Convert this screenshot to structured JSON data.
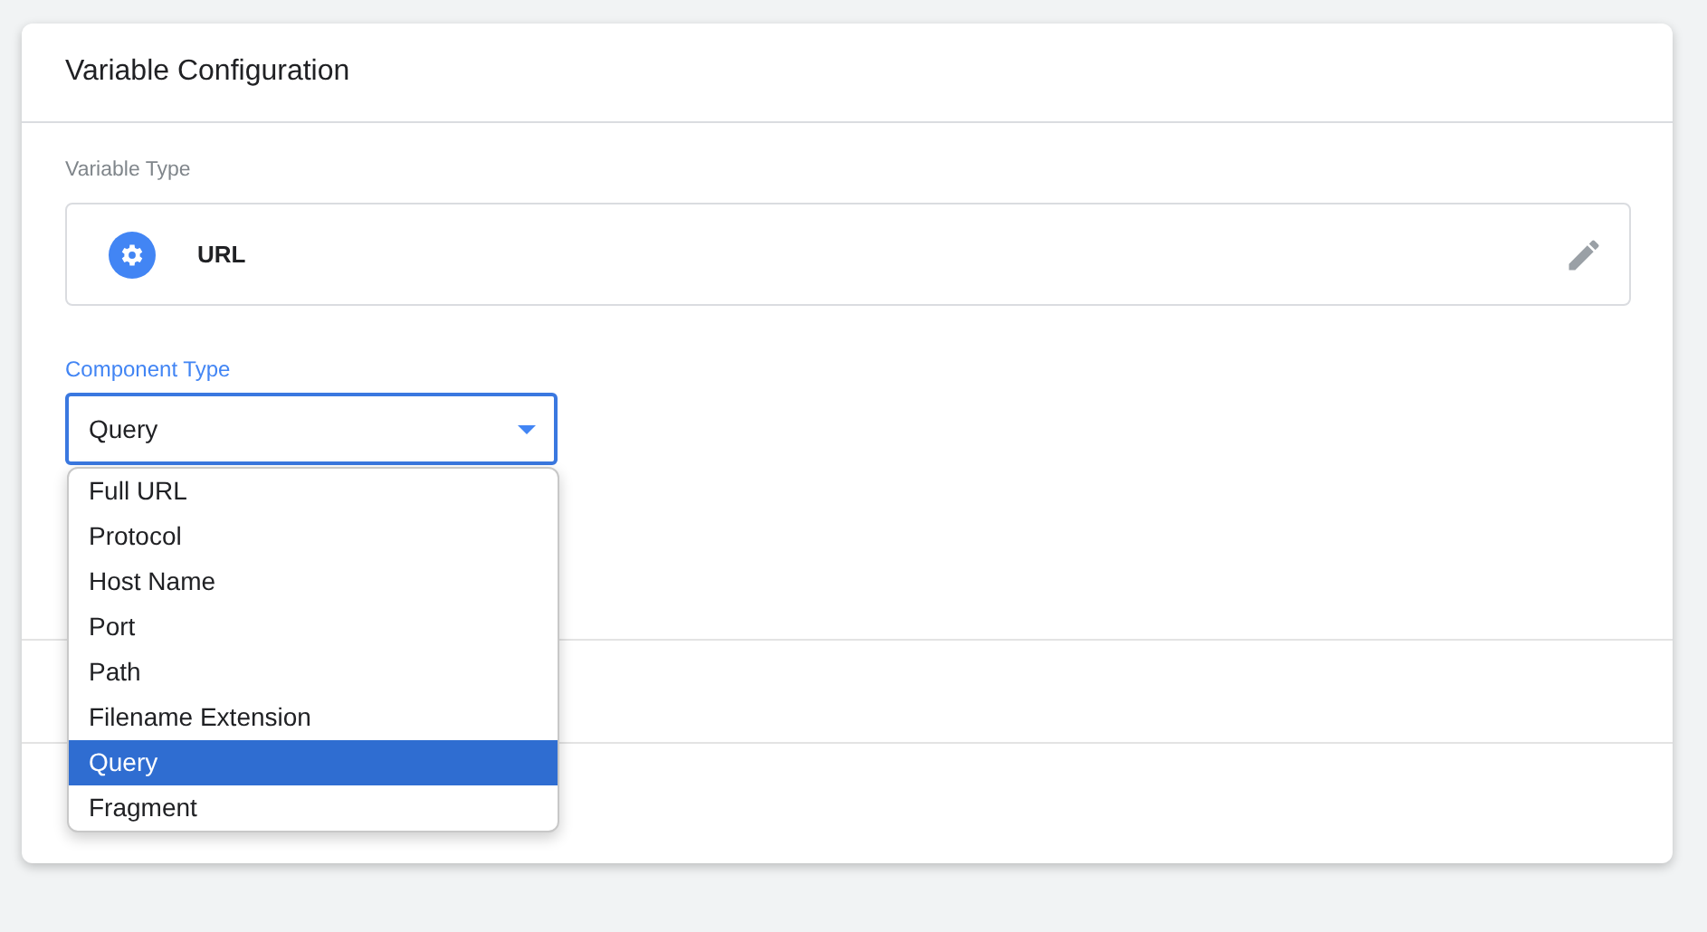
{
  "card": {
    "title": "Variable Configuration"
  },
  "variable_type": {
    "label": "Variable Type",
    "value": "URL"
  },
  "component_type": {
    "label": "Component Type",
    "value": "Query",
    "expanded": true,
    "options": [
      {
        "label": "Full URL",
        "selected": false
      },
      {
        "label": "Protocol",
        "selected": false
      },
      {
        "label": "Host Name",
        "selected": false
      },
      {
        "label": "Port",
        "selected": false
      },
      {
        "label": "Path",
        "selected": false
      },
      {
        "label": "Filename Extension",
        "selected": false
      },
      {
        "label": "Query",
        "selected": true
      },
      {
        "label": "Fragment",
        "selected": false
      }
    ]
  }
}
